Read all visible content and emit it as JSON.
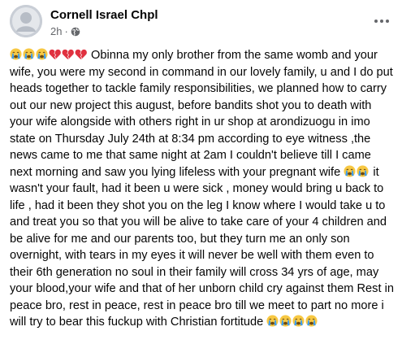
{
  "post": {
    "author": "Cornell Israel Chpl",
    "timestamp": "2h",
    "separator": "·",
    "privacy_icon": "globe-icon",
    "more_icon": "more-options-icon",
    "text_intro": " Obinna my only brother from the same womb and your wife, you were my second in command in our lovely family, u and I do put heads together to tackle family responsibilities, we planned how to carry out our new project this august, before bandits shot you to death with your wife alongside with others right in ur shop at arondizuogu in imo state on Thursday July 24th at 8:34 pm according to eye witness ,the news came to me that same night at 2am I couldn't believe till I came next morning and saw you lying lifeless with your pregnant wife ",
    "text_middle": " it wasn't your fault, had it been u were sick , money would bring u back to life , had it been they shot you on the leg I know where I would take u to and  treat you so that you will be alive to take care of your 4 children and be alive for me and our parents too, but they turn me an only son overnight, with tears in my eyes it will never be well with them even to their 6th generation no soul in their family will cross 34 yrs of age, may your blood,your wife and that of her unborn child cry against them Rest in peace bro, rest in peace, rest in peace bro till we meet to part no more i will try to bear this fuckup with Christian fortitude ",
    "emoji_cry": "crying-face-emoji",
    "emoji_heart": "broken-heart-emoji",
    "colors": {
      "text": "#050505",
      "secondary": "#65676b",
      "background": "#ffffff",
      "cry_face": "#f7c843",
      "tear": "#3b9cf0",
      "heart": "#e0313f"
    }
  }
}
